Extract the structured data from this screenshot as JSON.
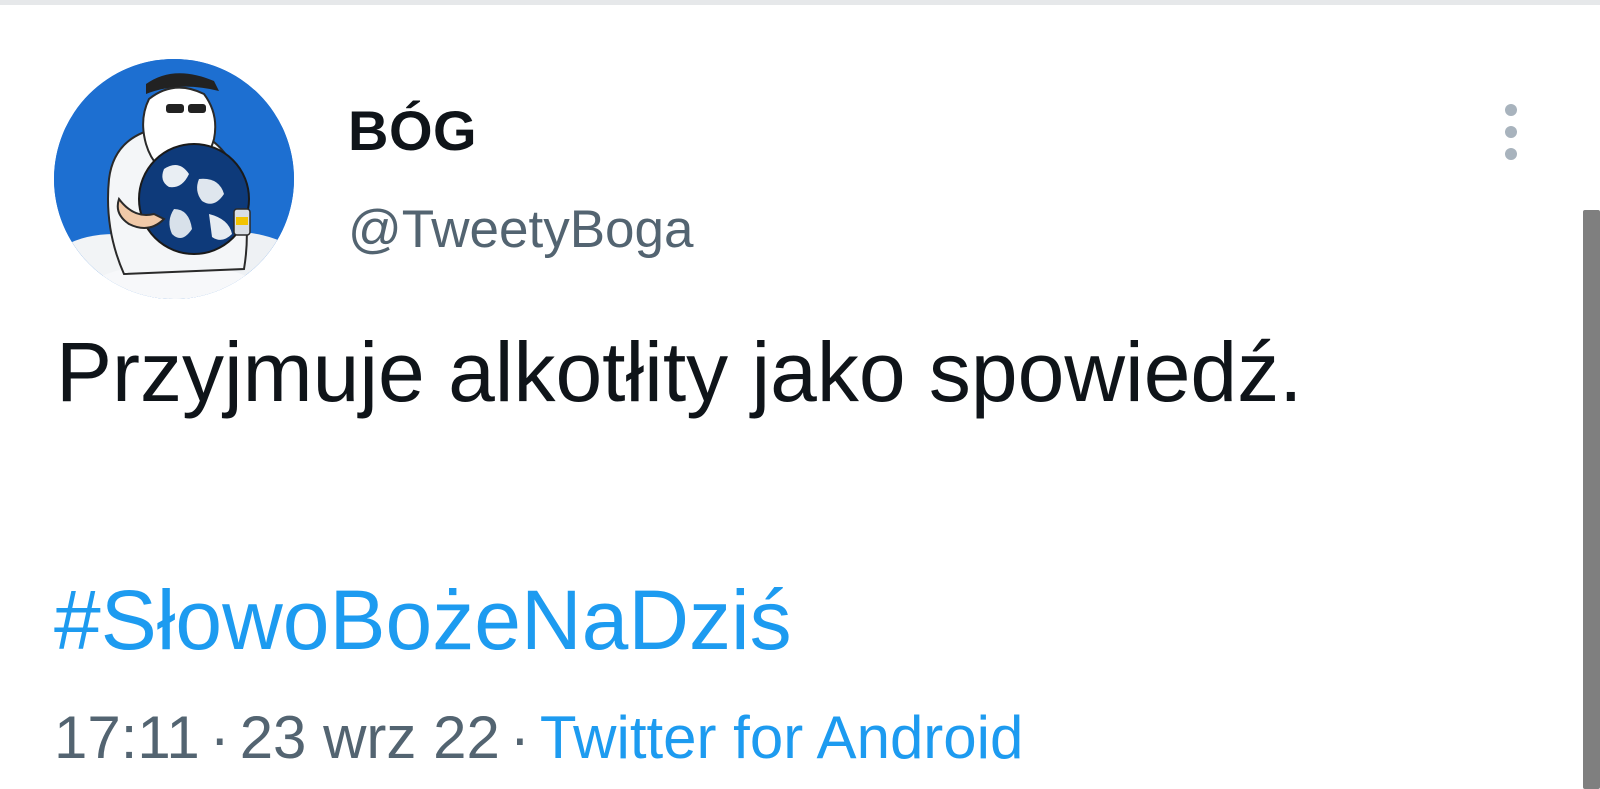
{
  "tweet": {
    "author": {
      "display_name": "BÓG",
      "handle": "@TweetyBoga"
    },
    "text": "Przyjmuje alkotłity jako spowiedź.",
    "hashtag": "#SłowoBożeNaDziś",
    "time": "17:11",
    "separator": "·",
    "date": "23 wrz 22",
    "source": "Twitter for Android"
  },
  "icons": {
    "more": "more-vertical-icon",
    "avatar": "avatar-image"
  },
  "colors": {
    "text_primary": "#0f1419",
    "text_secondary": "#536471",
    "accent": "#1d9bf0",
    "avatar_background": "#1d6fd1"
  }
}
